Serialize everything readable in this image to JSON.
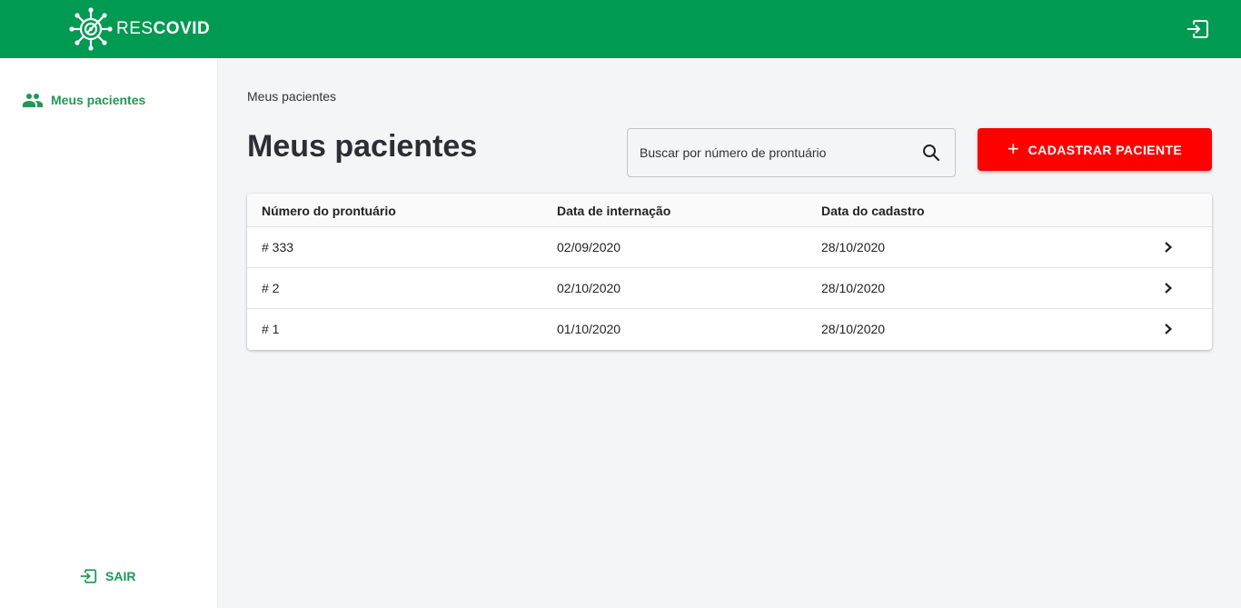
{
  "app": {
    "logo_part1": "RES",
    "logo_part2": "COVID"
  },
  "sidebar": {
    "items": [
      {
        "label": "Meus pacientes",
        "icon": "people-icon"
      }
    ],
    "logout_label": "SAIR"
  },
  "breadcrumb": "Meus pacientes",
  "page_title": "Meus pacientes",
  "search": {
    "placeholder": "Buscar por número de prontuário",
    "value": ""
  },
  "add_button_label": "CADASTRAR PACIENTE",
  "table": {
    "headers": [
      "Número do prontuário",
      "Data de internação",
      "Data do cadastro"
    ],
    "rows": [
      {
        "record": "# 333",
        "admission": "02/09/2020",
        "registered": "28/10/2020"
      },
      {
        "record": "# 2",
        "admission": "02/10/2020",
        "registered": "28/10/2020"
      },
      {
        "record": "# 1",
        "admission": "01/10/2020",
        "registered": "28/10/2020"
      }
    ]
  },
  "colors": {
    "brand_green": "#009a52",
    "accent_green_text": "#1e9a55",
    "add_button_red": "#ff0000"
  }
}
